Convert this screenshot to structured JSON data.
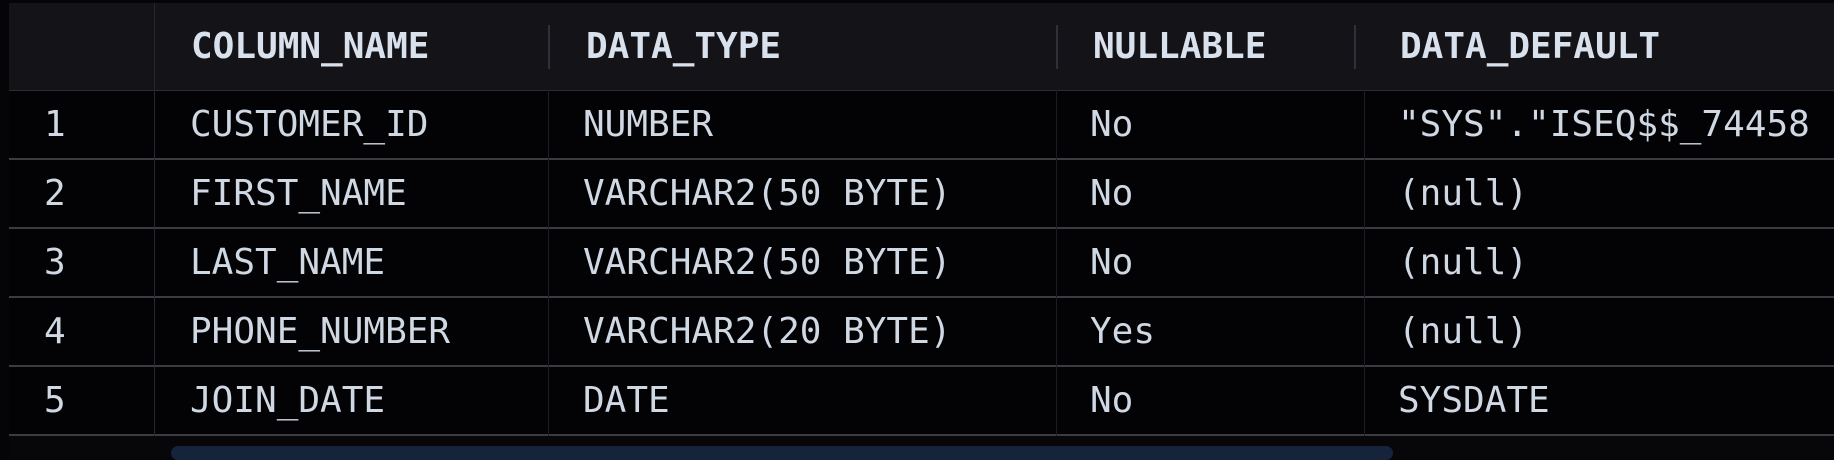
{
  "columns": {
    "column_name": "COLUMN_NAME",
    "data_type": "DATA_TYPE",
    "nullable": "NULLABLE",
    "data_default": "DATA_DEFAULT"
  },
  "rows": [
    {
      "num": "1",
      "column_name": "CUSTOMER_ID",
      "data_type": "NUMBER",
      "nullable": "No",
      "data_default": "\"SYS\".\"ISEQ$$_74458"
    },
    {
      "num": "2",
      "column_name": "FIRST_NAME",
      "data_type": "VARCHAR2(50 BYTE)",
      "nullable": "No",
      "data_default": "(null)"
    },
    {
      "num": "3",
      "column_name": "LAST_NAME",
      "data_type": "VARCHAR2(50 BYTE)",
      "nullable": "No",
      "data_default": "(null)"
    },
    {
      "num": "4",
      "column_name": "PHONE_NUMBER",
      "data_type": "VARCHAR2(20 BYTE)",
      "nullable": "Yes",
      "data_default": "(null)"
    },
    {
      "num": "5",
      "column_name": "JOIN_DATE",
      "data_type": "DATE",
      "nullable": "No",
      "data_default": "SYSDATE"
    }
  ],
  "colors": {
    "header_bg": "#131318",
    "row_bg": "#030305",
    "text": "#cfd8e3",
    "scroll_thumb": "#15233b"
  }
}
